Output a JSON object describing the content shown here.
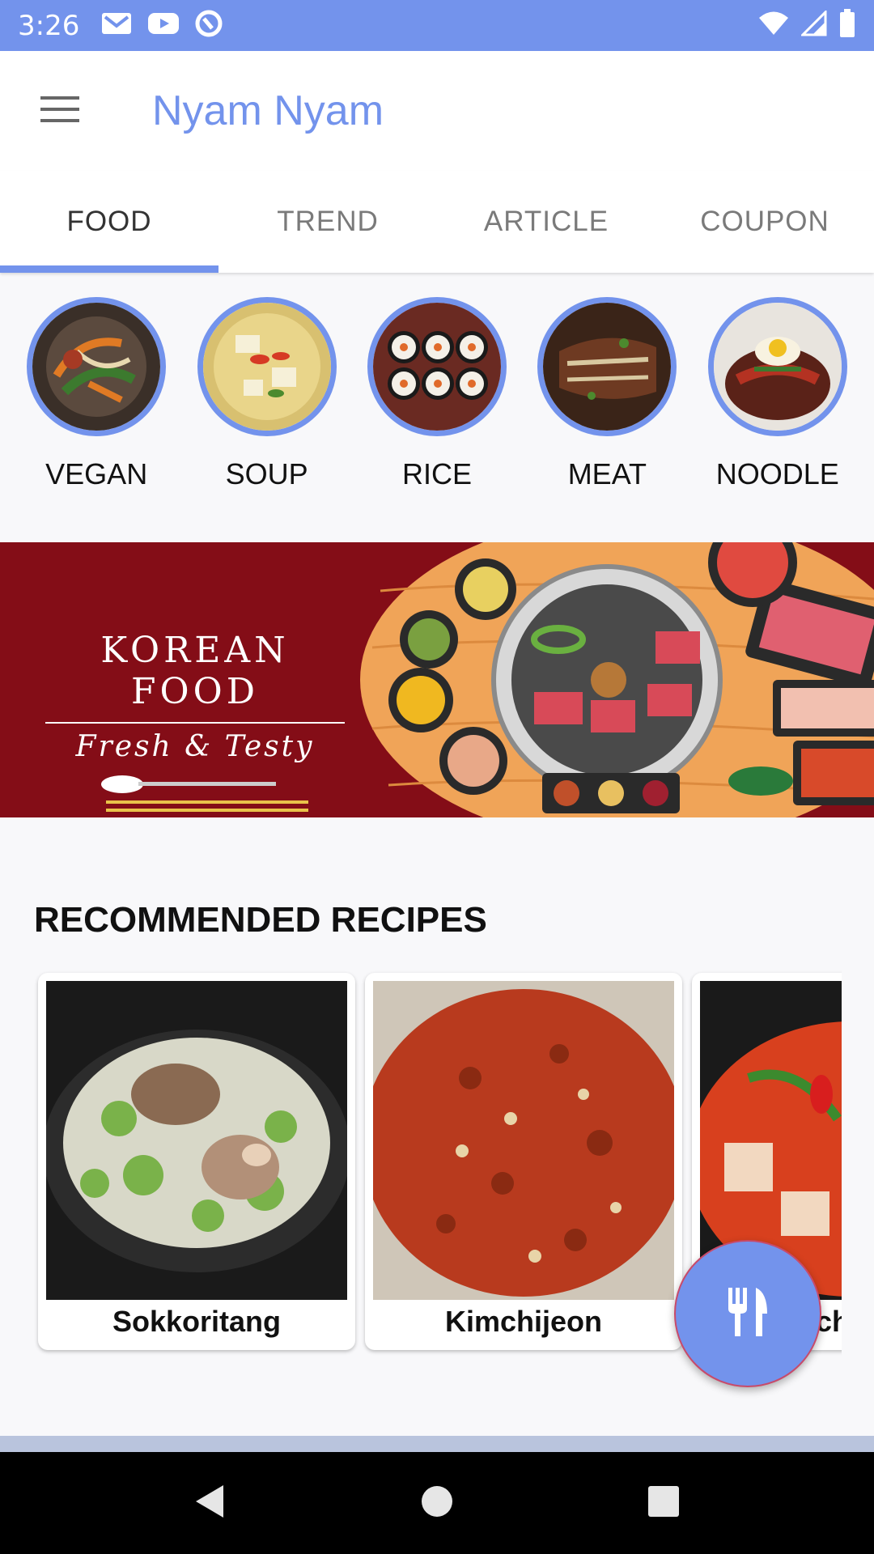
{
  "status_bar": {
    "time": "3:26",
    "left_icons": [
      "gmail-icon",
      "youtube-icon",
      "sync-icon"
    ],
    "right_icons": [
      "wifi-icon",
      "signal-icon",
      "battery-icon"
    ]
  },
  "app_bar": {
    "title": "Nyam Nyam",
    "menu_icon": "hamburger-menu-icon"
  },
  "tabs": [
    {
      "label": "FOOD",
      "active": true
    },
    {
      "label": "TREND",
      "active": false
    },
    {
      "label": "ARTICLE",
      "active": false
    },
    {
      "label": "COUPON",
      "active": false
    }
  ],
  "categories": [
    {
      "label": "VEGAN"
    },
    {
      "label": "SOUP"
    },
    {
      "label": "RICE"
    },
    {
      "label": "MEAT"
    },
    {
      "label": "NOODLE"
    }
  ],
  "banner": {
    "title": "KOREAN FOOD",
    "subtitle": "Fresh & Testy"
  },
  "recommended": {
    "heading": "RECOMMENDED RECIPES",
    "items": [
      {
        "title": "Sokkoritang"
      },
      {
        "title": "Kimchijeon"
      },
      {
        "title": "Kimchi jjigae"
      }
    ]
  },
  "fab": {
    "icon": "fork-knife-icon"
  },
  "nav": [
    "back-icon",
    "home-icon",
    "recents-icon"
  ],
  "colors": {
    "accent": "#7393ec",
    "banner_bg": "#840d17"
  }
}
